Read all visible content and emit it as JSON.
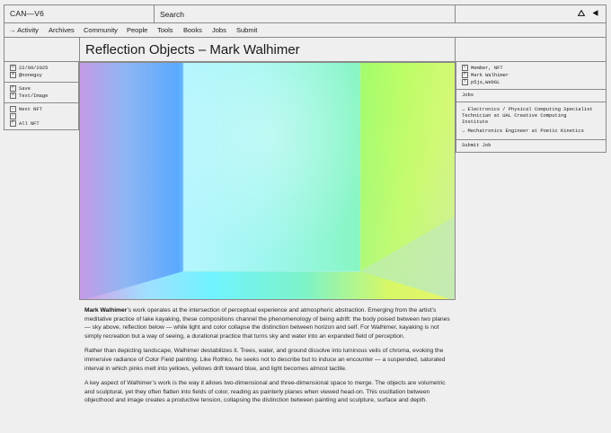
{
  "header": {
    "logo": "CAN—V6",
    "search_placeholder": "Search",
    "icons": [
      "triangle-up-icon",
      "triangle-left-icon"
    ]
  },
  "nav": {
    "items": [
      "→ Activity",
      "Archives",
      "Community",
      "People",
      "Tools",
      "Books",
      "Jobs",
      "Submit"
    ]
  },
  "page": {
    "title": "Reflection Objects – Mark Walhimer"
  },
  "left_panel": {
    "meta": [
      {
        "key": "D",
        "value": "22/09/2025"
      },
      {
        "key": "A",
        "value": "@noneguy"
      }
    ],
    "actions": [
      {
        "key": "P",
        "value": "Save"
      },
      {
        "key": "S",
        "value": "Text/Image"
      }
    ],
    "nft": [
      {
        "key": "→",
        "value": "Next NFT"
      },
      {
        "key": "←",
        "value": ""
      },
      {
        "key": "F",
        "value": "All NFT"
      }
    ]
  },
  "right_panel": {
    "meta": [
      {
        "key": "C",
        "value": "Member, NFT"
      },
      {
        "key": "P",
        "value": "Mark Walhimer"
      },
      {
        "key": "T",
        "value": "p5js,WebGL"
      }
    ],
    "jobs_heading": "Jobs",
    "jobs": [
      "→ Electronics / Physical Computing Specialist Technician at UAL Creative Computing Institute",
      "→ Mechatronics Engineer at Poetic Kinetics"
    ],
    "submit_job": "Submit Job"
  },
  "article": {
    "p1_name": "Mark Walhimer",
    "p1_rest": "’s work operates at the intersection of perceptual experience and atmospheric abstraction. Emerging from the artist’s meditative practice of lake kayaking, these compositions channel the phenomenology of being adrift: the body poised between two planes — sky above, reflection below — while light and color collapse the distinction between horizon and self. For Walhimer, kayaking is not simply recreation but a way of seeing, a durational practice that turns sky and water into an expanded field of perception.",
    "p2": "Rather than depicting landscape, Walhimer destabilizes it. Trees, water, and ground dissolve into luminous veils of chroma, evoking the immersive radiance of Color Field painting. Like Rothko, he seeks not to describe but to induce an encounter — a suspended, saturated interval in which pinks melt into yellows, yellows drift toward blue, and light becomes almost tactile.",
    "p3": "A key aspect of Walhimer’s work is the way it allows two-dimensional and three-dimensional space to merge. The objects are volumetric and sculptural, yet they often flatten into fields of color, reading as painterly planes when viewed head-on. This oscillation between objecthood and image creates a productive tension, collapsing the distinction between painting and sculpture, surface and depth."
  }
}
